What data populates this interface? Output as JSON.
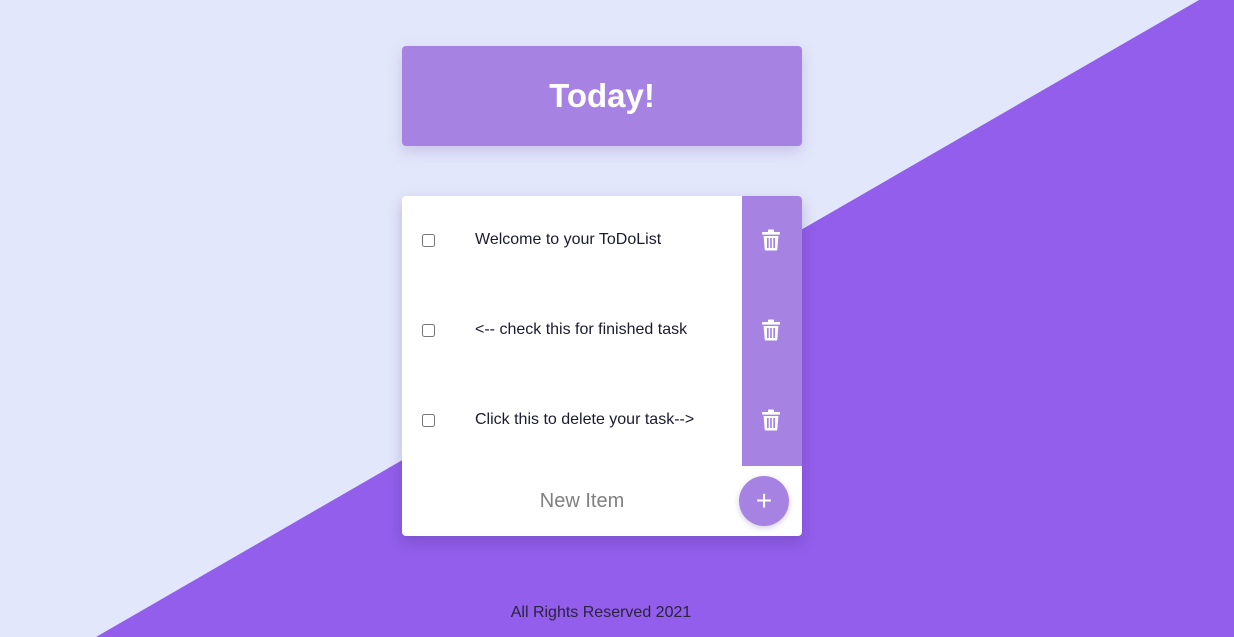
{
  "colors": {
    "background_light": "#e3e7fb",
    "background_purple": "#925eeb",
    "accent": "#a683e3",
    "card": "#ffffff"
  },
  "header": {
    "title": "Today!"
  },
  "todo": {
    "items": [
      {
        "text": "Welcome to your ToDoList",
        "checked": false,
        "delete_icon": "trash-icon"
      },
      {
        "text": "<-- check this for finished task",
        "checked": false,
        "delete_icon": "trash-icon"
      },
      {
        "text": "Click this to delete your task-->",
        "checked": false,
        "delete_icon": "trash-icon"
      }
    ],
    "new_item": {
      "placeholder": "New Item",
      "value": ""
    },
    "add_button_label": "+"
  },
  "footer": {
    "text": "All Rights Reserved 2021"
  }
}
